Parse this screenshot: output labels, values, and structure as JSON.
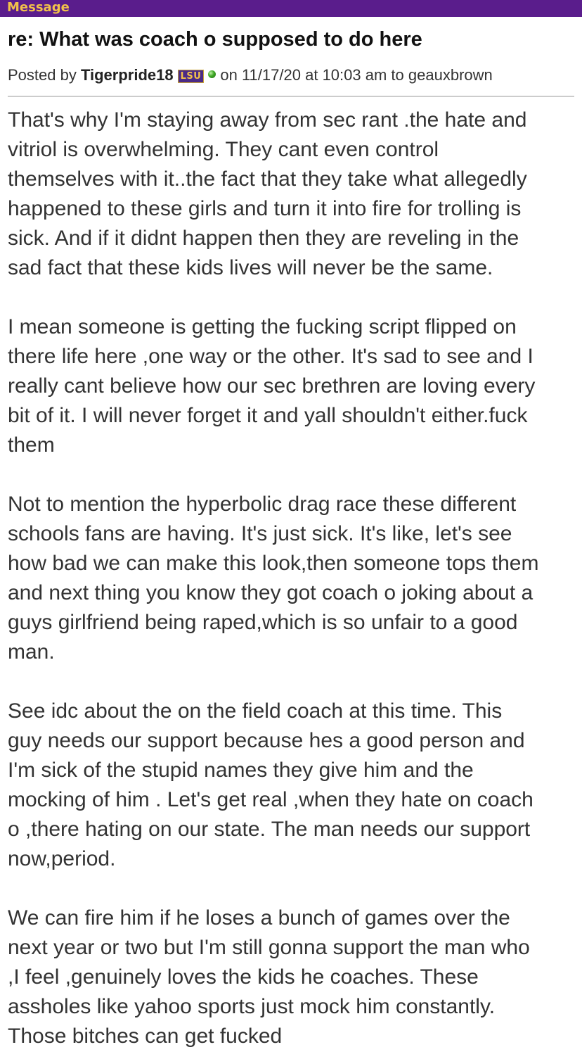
{
  "header": {
    "label": "Message"
  },
  "post": {
    "title": "re: What was coach o supposed to do here",
    "meta": {
      "posted_by_label": "Posted by",
      "author": "Tigerpride18",
      "badge_text": "LSU",
      "on_label": "on",
      "date": "11/17/20",
      "at_label": "at",
      "time": "10:03 am",
      "to_label": "to",
      "recipient": "geauxbrown"
    },
    "paragraphs": [
      {
        "lines": [
          "That's why I'm staying away from sec rant .the hate and",
          "vitriol is overwhelming. They cant even control",
          "themselves with it..the fact that they take what allegedly",
          "happened to these girls and turn it into fire for trolling is",
          "sick. And if it didnt happen then they are reveling in the",
          "sad fact that these kids lives will never be the same."
        ]
      },
      {
        "lines": [
          "I mean someone is getting the fucking script flipped on",
          "there life here ,one way or the other. It's sad to see and I",
          "really cant believe how our sec brethren are loving every",
          "bit of it. I will never forget it and yall shouldn't either.fuck",
          "them"
        ]
      },
      {
        "lines": [
          "Not to mention the hyperbolic drag race these different",
          "schools fans are having. It's just sick. It's like, let's see",
          "how bad we can make this look,then someone tops them",
          "and next thing you know they got coach o joking about a",
          "guys girlfriend being raped,which is so unfair to a good",
          "man."
        ]
      },
      {
        "lines": [
          "See idc about the on the field coach at this time. This",
          "guy needs our support because hes a good person and",
          "I'm sick of the stupid names they give him and the",
          "mocking of him . Let's get real ,when they hate on coach",
          "o ,there hating on our state. The man needs our support",
          "now,period."
        ]
      },
      {
        "lines": [
          "We can fire him if he loses a bunch of games over the",
          "next year or two but I'm still gonna support the man who",
          ",I feel ,genuinely loves the kids he coaches. These",
          "assholes like yahoo sports just mock him constantly.",
          "Those bitches can get fucked"
        ]
      }
    ]
  },
  "colors": {
    "header_bg": "#5a1d8c",
    "header_text": "#f2c24a",
    "body_text": "#333333",
    "divider": "#cccccc",
    "status_dot": "#3fa826"
  },
  "icons": {
    "status": "online-status-dot-icon",
    "team_badge": "lsu-team-badge-icon"
  }
}
